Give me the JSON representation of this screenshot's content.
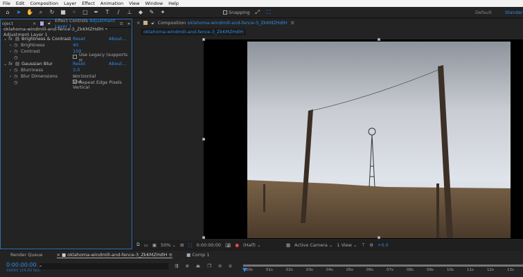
{
  "menu": [
    "File",
    "Edit",
    "Composition",
    "Layer",
    "Effect",
    "Animation",
    "View",
    "Window",
    "Help"
  ],
  "toolbar": {
    "snapping": "Snapping",
    "workspaces": [
      "Default",
      "Standard"
    ]
  },
  "left_panel": {
    "tab_project": "oject",
    "tab_effect_controls": "Effect Controls",
    "layer_name": "Adjustment Layer 1",
    "header": "oklahoma-windmill-and-fence-3_ZkKMZHdlH • Adjustment Layer 1",
    "effects": [
      {
        "name": "Brightness & Contrast",
        "reset": "Reset",
        "about": "About...",
        "props": [
          {
            "label": "Brightness",
            "value": "40"
          },
          {
            "label": "Contrast",
            "value": "100"
          },
          {
            "label": "",
            "value": "Use Legacy (supports H",
            "checkbox": true
          }
        ]
      },
      {
        "name": "Gaussian Blur",
        "reset": "Reset",
        "about": "About...",
        "props": [
          {
            "label": "Blurriness",
            "value": "3.0"
          },
          {
            "label": "Blur Dimensions",
            "value": "Horizontal and Vertical",
            "dropdown": true
          },
          {
            "label": "",
            "value": "Repeat Edge Pixels",
            "checkbox": true
          }
        ]
      }
    ]
  },
  "composition": {
    "tab_label": "Composition",
    "comp_name": "oklahoma-windmill-and-fence-3_ZkKMZHdlH",
    "breadcrumb": "oklahoma-windmill-and-fence-3_ZkKMZHdlH"
  },
  "viewer_bar": {
    "zoom": "50%",
    "timecode": "0:00:00:00",
    "resolution": "(Half)",
    "camera": "Active Camera",
    "views": "1 View",
    "exposure": "+0.0"
  },
  "timeline": {
    "tabs": [
      "Render Queue",
      "oklahoma-windmill-and-fence-3_ZkKMZHdlH",
      "Comp 1"
    ],
    "timecode": "0:00:00:00",
    "frames": "00000 (24.00 fps)",
    "ticks": [
      "00s",
      "01s",
      "02s",
      "03s",
      "04s",
      "05s",
      "06s",
      "07s",
      "08s",
      "09s",
      "10s",
      "11s",
      "12s",
      "13s"
    ]
  },
  "colors": {
    "accent": "#2d8ceb",
    "panel": "#232323"
  }
}
